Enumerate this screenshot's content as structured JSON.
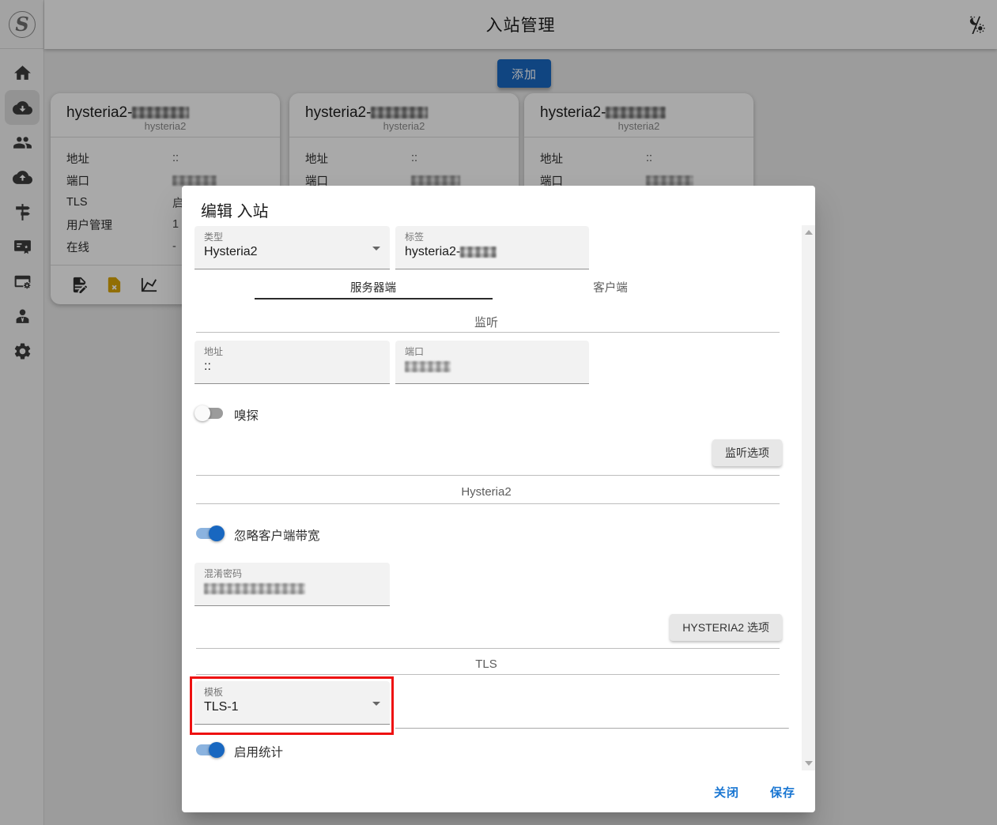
{
  "colors": {
    "primary": "#1867c0",
    "link": "#1976d2",
    "annotation": "#ee1111",
    "warning": "#d9a406"
  },
  "app_bar": {
    "title": "入站管理",
    "logo_letter": "S",
    "theme_icon": "theme-light-dark-icon"
  },
  "sidebar": {
    "items": [
      {
        "id": "home",
        "icon": "home-icon"
      },
      {
        "id": "inbounds",
        "icon": "cloud-download-icon",
        "active": true
      },
      {
        "id": "clients",
        "icon": "users-icon"
      },
      {
        "id": "outbounds",
        "icon": "cloud-upload-icon"
      },
      {
        "id": "rules",
        "icon": "signpost-icon"
      },
      {
        "id": "tls",
        "icon": "certificate-icon"
      },
      {
        "id": "panel-settings",
        "icon": "server-cog-icon"
      },
      {
        "id": "admin",
        "icon": "account-tie-icon"
      },
      {
        "id": "settings",
        "icon": "gear-icon"
      }
    ]
  },
  "content": {
    "add_button": "添加"
  },
  "cards": [
    {
      "title_prefix": "hysteria2-",
      "subtitle": "hysteria2",
      "rows": [
        {
          "label": "地址",
          "value": "::"
        },
        {
          "label": "端口",
          "value_masked": true
        },
        {
          "label": "TLS",
          "value": "启用"
        },
        {
          "label": "用户管理",
          "value": "1"
        },
        {
          "label": "在线",
          "value": "-"
        }
      ],
      "actions": [
        "file-edit-icon",
        "file-remove-icon",
        "chart-line-icon"
      ]
    },
    {
      "title_prefix": "hysteria2-",
      "subtitle": "hysteria2",
      "rows": [
        {
          "label": "地址",
          "value": "::"
        },
        {
          "label": "端口",
          "value_masked": true
        }
      ]
    },
    {
      "title_prefix": "hysteria2-",
      "subtitle": "hysteria2",
      "rows": [
        {
          "label": "地址",
          "value": "::"
        },
        {
          "label": "端口",
          "value_masked": true
        }
      ]
    }
  ],
  "modal": {
    "title": "编辑 入站",
    "type_field": {
      "label": "类型",
      "value": "Hysteria2"
    },
    "tag_field": {
      "label": "标签",
      "value_prefix": "hysteria2-",
      "value_masked": true
    },
    "tabs": {
      "server": "服务器端",
      "client": "客户端"
    },
    "listen": {
      "title": "监听",
      "address_label": "地址",
      "address_value": "::",
      "port_label": "端口",
      "port_masked": true,
      "sniff_label": "嗅探",
      "sniff_on": false,
      "options_button": "监听选项"
    },
    "hysteria2": {
      "title": "Hysteria2",
      "ignore_bandwidth_label": "忽略客户端带宽",
      "ignore_bandwidth_on": true,
      "obfs_label": "混淆密码",
      "obfs_masked": true,
      "options_button": "HYSTERIA2 选项"
    },
    "tls": {
      "title": "TLS",
      "template_label": "模板",
      "template_value": "TLS-1",
      "stats_label": "启用统计",
      "stats_on": true
    },
    "footer": {
      "close": "关闭",
      "save": "保存"
    }
  }
}
